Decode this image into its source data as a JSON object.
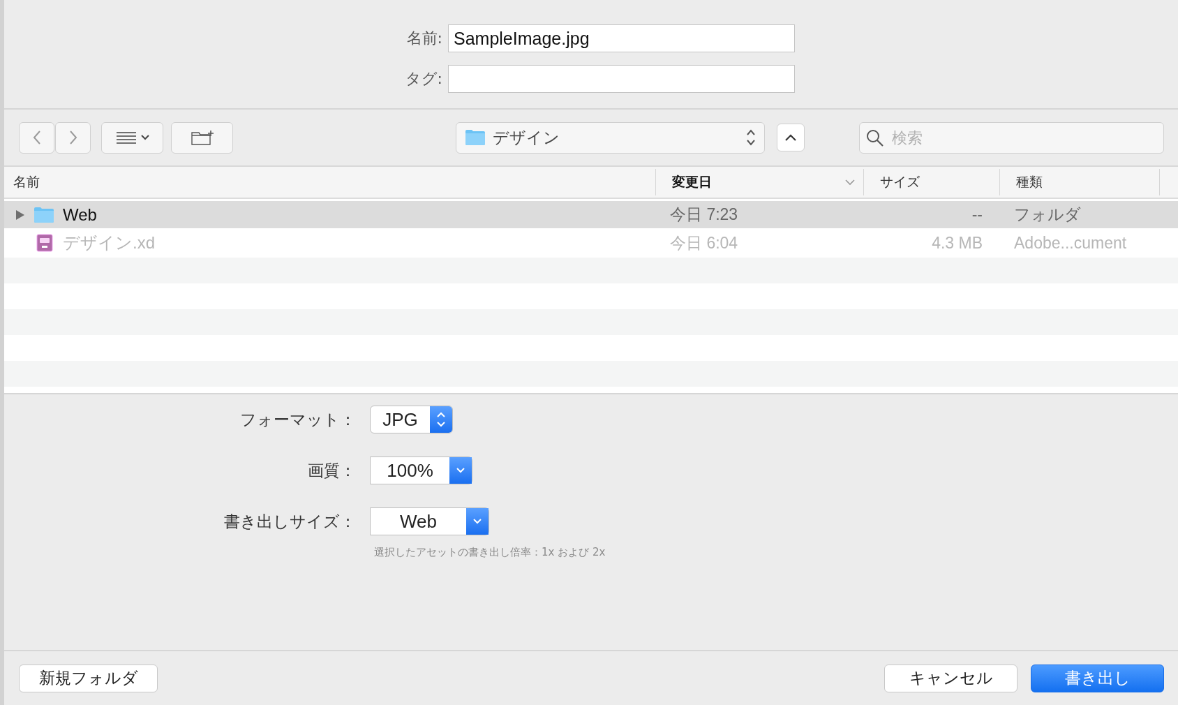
{
  "fields": [
    {
      "label": "名前:",
      "value": "SampleImage.jpg"
    },
    {
      "label": "タグ:"
    }
  ],
  "toolbar": {
    "location": "デザイン",
    "search": {
      "placeholder": "検索"
    }
  },
  "columns": [
    {
      "label": "名前",
      "sorted": false
    },
    {
      "label": "変更日",
      "sorted": true
    },
    {
      "label": "サイズ",
      "sorted": false
    },
    {
      "label": "種類",
      "sorted": false
    }
  ],
  "files": [
    {
      "kind": "folder",
      "name": "Web",
      "modified": "今日 7:23",
      "size": "--",
      "type": "フォルダ",
      "selected": true,
      "disabled": false
    },
    {
      "kind": "xd",
      "name": "デザイン.xd",
      "modified": "今日 6:04",
      "size": "4.3 MB",
      "type": "Adobe...cument",
      "selected": false,
      "disabled": true
    }
  ],
  "options": [
    {
      "kind": "stepper",
      "label": "フォーマット：",
      "value": "JPG"
    },
    {
      "kind": "dropdown",
      "label": "画質：",
      "value": "100%"
    },
    {
      "kind": "dropdown",
      "label": "書き出しサイズ：",
      "value": "Web"
    }
  ],
  "hint": "選択したアセットの書き出し倍率：1x および 2x",
  "buttons": [
    {
      "label": "新規フォルダ",
      "kind": "secondary"
    },
    {
      "label": "キャンセル",
      "kind": "secondary"
    },
    {
      "label": "書き出し",
      "kind": "primary"
    }
  ]
}
